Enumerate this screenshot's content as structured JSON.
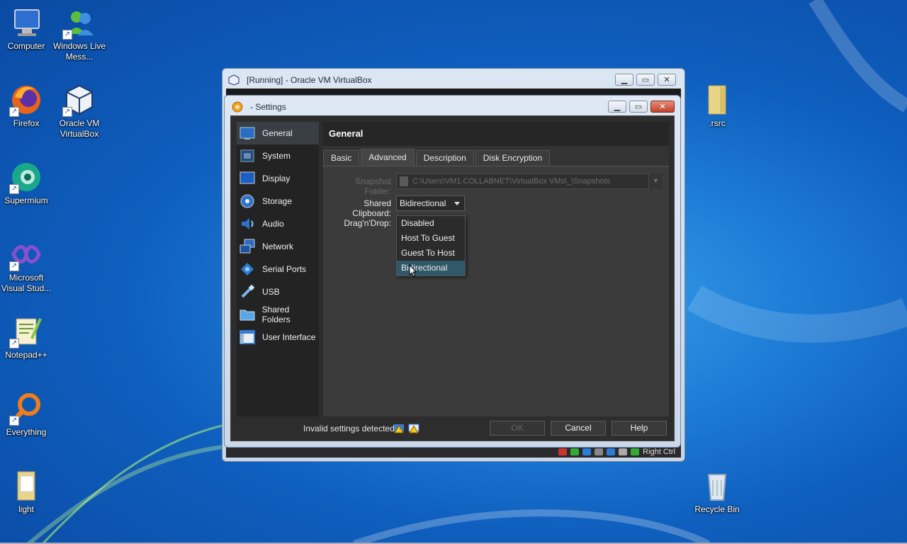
{
  "desktop": {
    "icons": [
      {
        "label": "Computer"
      },
      {
        "label": "Windows Live Mess..."
      },
      {
        "label": "Firefox"
      },
      {
        "label": "Oracle VM VirtualBox"
      },
      {
        "label": "Supermium"
      },
      {
        "label": "Microsoft Visual Stud..."
      },
      {
        "label": "Notepad++"
      },
      {
        "label": "Everything"
      },
      {
        "label": "light"
      },
      {
        "label": ".rsrc"
      },
      {
        "label": "Recycle Bin"
      }
    ]
  },
  "vbox_window": {
    "title": "[Running] - Oracle VM VirtualBox",
    "status_right": "Right Ctrl"
  },
  "settings": {
    "title": "- Settings",
    "sidebar": [
      {
        "label": "General",
        "icon": "general-icon"
      },
      {
        "label": "System",
        "icon": "system-icon"
      },
      {
        "label": "Display",
        "icon": "display-icon"
      },
      {
        "label": "Storage",
        "icon": "storage-icon"
      },
      {
        "label": "Audio",
        "icon": "audio-icon"
      },
      {
        "label": "Network",
        "icon": "network-icon"
      },
      {
        "label": "Serial Ports",
        "icon": "serial-ports-icon"
      },
      {
        "label": "USB",
        "icon": "usb-icon"
      },
      {
        "label": "Shared Folders",
        "icon": "shared-folders-icon"
      },
      {
        "label": "User Interface",
        "icon": "user-interface-icon"
      }
    ],
    "panel_title": "General",
    "tabs": [
      "Basic",
      "Advanced",
      "Description",
      "Disk Encryption"
    ],
    "active_tab": "Advanced",
    "snapshot_folder_label": "Snapshot Folder:",
    "snapshot_folder_value": "C:\\Users\\VM1.COLLABNET\\VirtualBox VMs\\_\\Snapshots",
    "shared_clipboard_label": "Shared Clipboard:",
    "shared_clipboard_value": "Bidirectional",
    "dragndrop_label": "Drag'n'Drop:",
    "dragndrop_options": [
      "Disabled",
      "Host To Guest",
      "Guest To Host",
      "Bidirectional"
    ],
    "dragndrop_highlighted": "Bidirectional",
    "footer": {
      "warning_text": "Invalid settings detected",
      "ok": "OK",
      "cancel": "Cancel",
      "help": "Help"
    }
  }
}
